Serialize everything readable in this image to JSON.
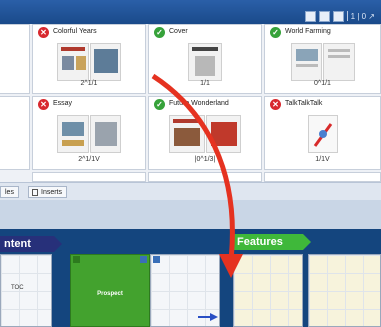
{
  "toolbar": {
    "icons": [
      "grid-view-icon",
      "list-view-icon",
      "layout-icon"
    ],
    "page_indicator": "1 | 0 ↗"
  },
  "thumbnails": [
    {
      "title": "Colorful Years",
      "status": "error",
      "count": "2^1/1"
    },
    {
      "title": "Cover",
      "status": "ok",
      "count": "1/1"
    },
    {
      "title": "World Farming",
      "status": "ok",
      "count": "0^1/1"
    },
    {
      "title": "Essay",
      "status": "error",
      "count": "2^1/1V"
    },
    {
      "title": "Future Wonderland",
      "status": "ok",
      "count": "|0^1/3|"
    },
    {
      "title": "TalkTalkTalk",
      "status": "error",
      "count": "1/1V"
    }
  ],
  "tabs": {
    "tab1": "les",
    "tab2": "Inserts"
  },
  "sections": {
    "content": "ntent",
    "features": "Features"
  },
  "flatplan": {
    "toc_label": "TOC",
    "project_label": "Prospect"
  },
  "colors": {
    "content_bar": "#27307a",
    "features_bar": "#3fb83a",
    "project_block": "#43a22e",
    "arrow": "#e53220"
  }
}
